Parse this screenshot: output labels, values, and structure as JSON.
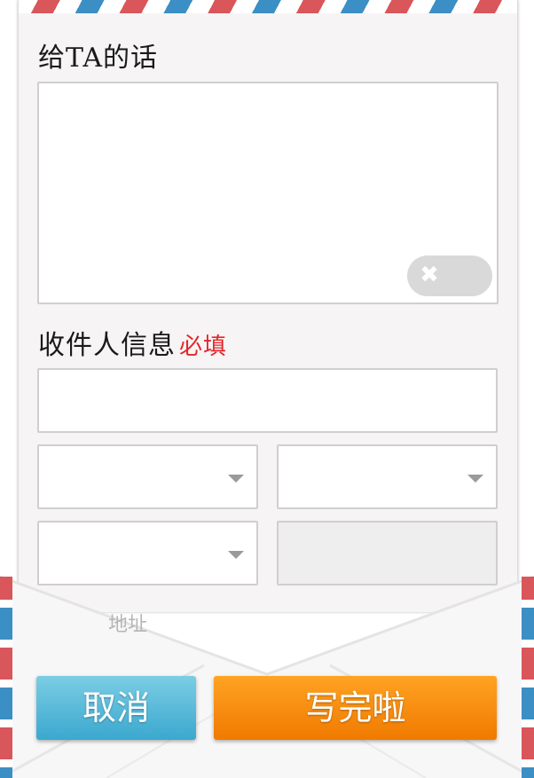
{
  "message_section": {
    "title": "给TA的话",
    "message_value": "",
    "clear_toggle_icon": "close-icon"
  },
  "recipient_section": {
    "title": "收件人信息",
    "required_label": "必填",
    "name_value": "",
    "province_select": "",
    "city_select": "",
    "district_select": "",
    "postcode_value": ""
  },
  "address_hint": "地址",
  "actions": {
    "cancel_label": "取消",
    "done_label": "写完啦"
  },
  "colors": {
    "stripe_red": "#d9565a",
    "stripe_blue": "#3b8fc4",
    "cancel": "#3aa8cf",
    "done": "#f07a00",
    "required": "#e3262b"
  }
}
